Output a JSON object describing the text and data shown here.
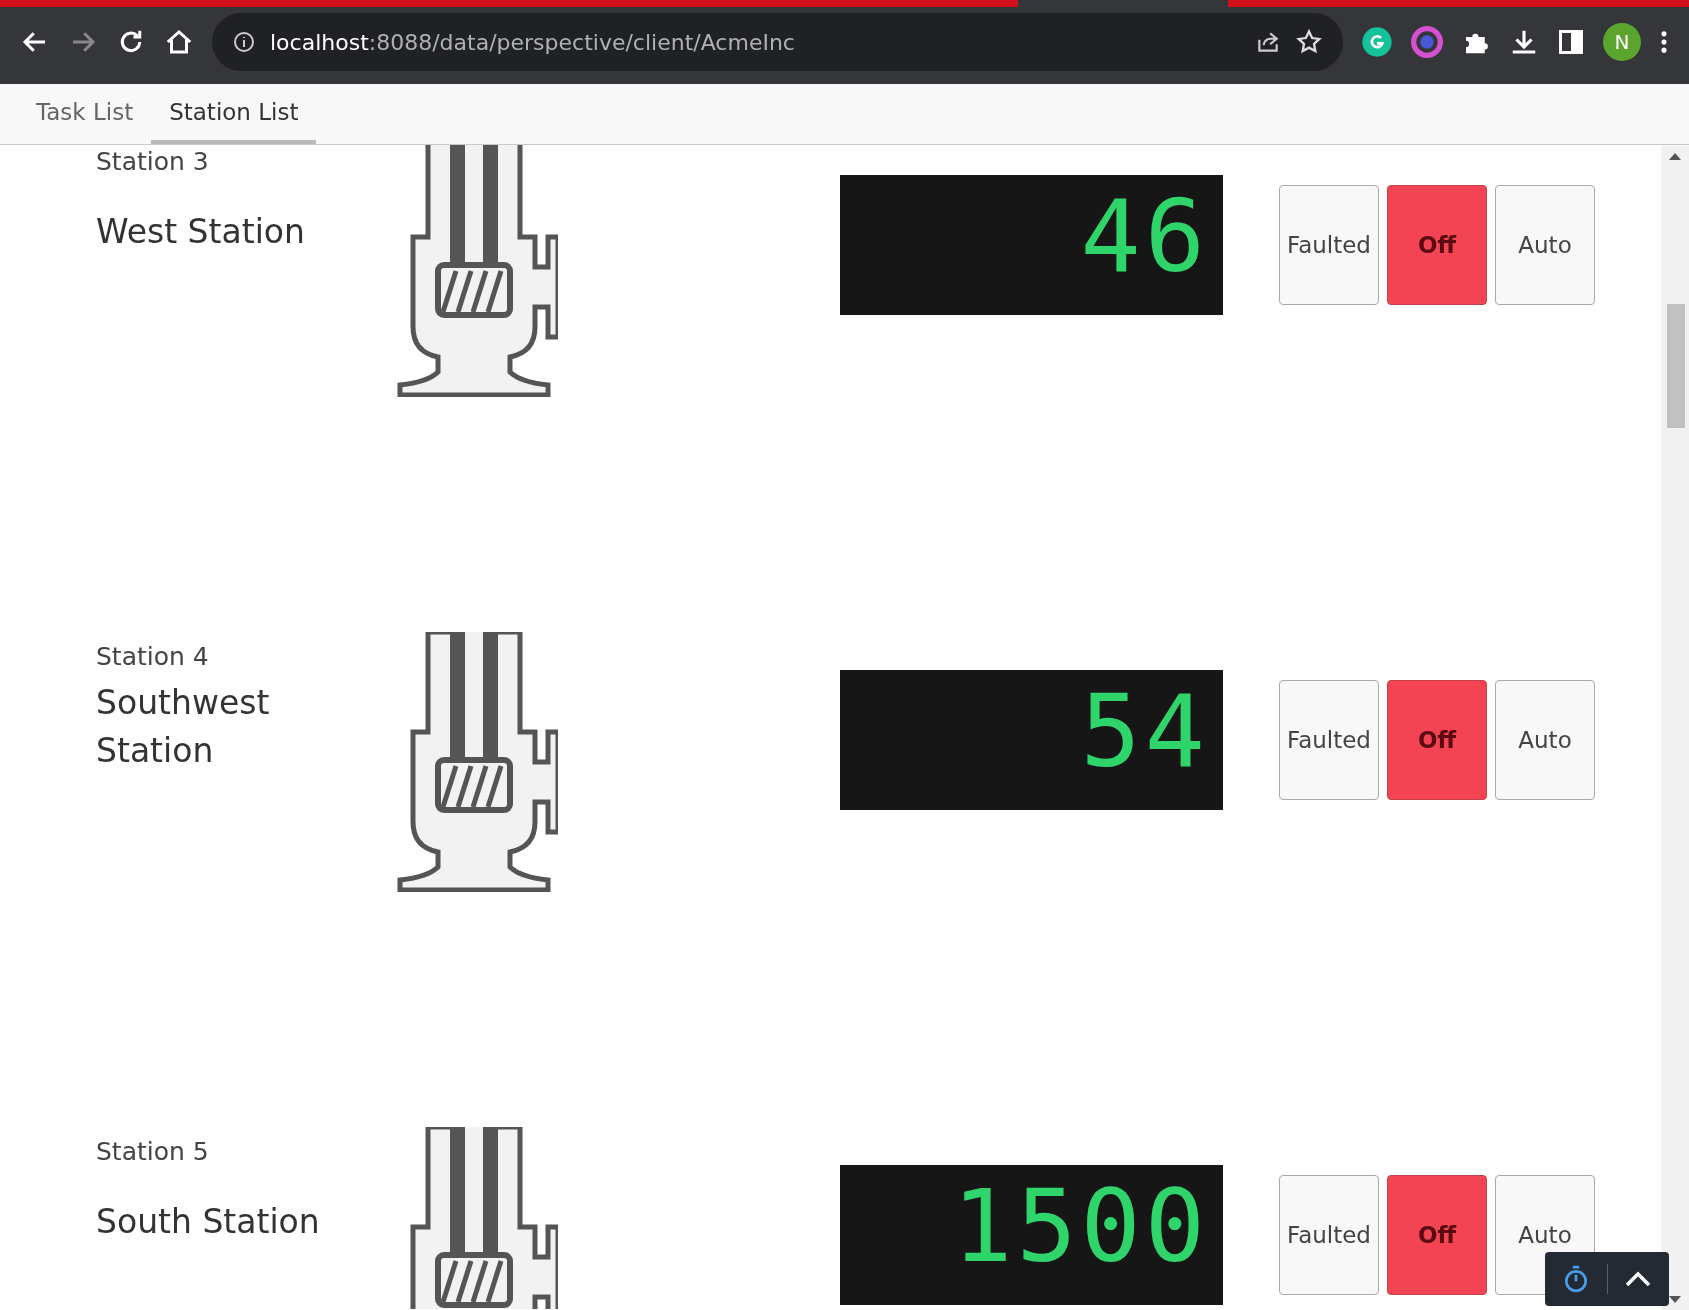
{
  "browser": {
    "url": "**localhost**:8088/data/perspective/client/AcmeInc",
    "profile_initial": "N"
  },
  "tabs": [
    {
      "label": "Task List",
      "selected": false
    },
    {
      "label": "Station List",
      "selected": true
    }
  ],
  "stations": [
    {
      "label": "Station 3",
      "name": "West Station",
      "display": "46",
      "modes": [
        {
          "label": "Faulted",
          "selected": false
        },
        {
          "label": "Off",
          "selected": true
        },
        {
          "label": "Auto",
          "selected": false
        }
      ]
    },
    {
      "label": "Station 4",
      "name": "Southwest Station",
      "display": "54",
      "modes": [
        {
          "label": "Faulted",
          "selected": false
        },
        {
          "label": "Off",
          "selected": true
        },
        {
          "label": "Auto",
          "selected": false
        }
      ]
    },
    {
      "label": "Station 5",
      "name": "South Station",
      "display": "1500",
      "modes": [
        {
          "label": "Faulted",
          "selected": false
        },
        {
          "label": "Off",
          "selected": true
        },
        {
          "label": "Auto",
          "selected": false
        }
      ]
    }
  ]
}
